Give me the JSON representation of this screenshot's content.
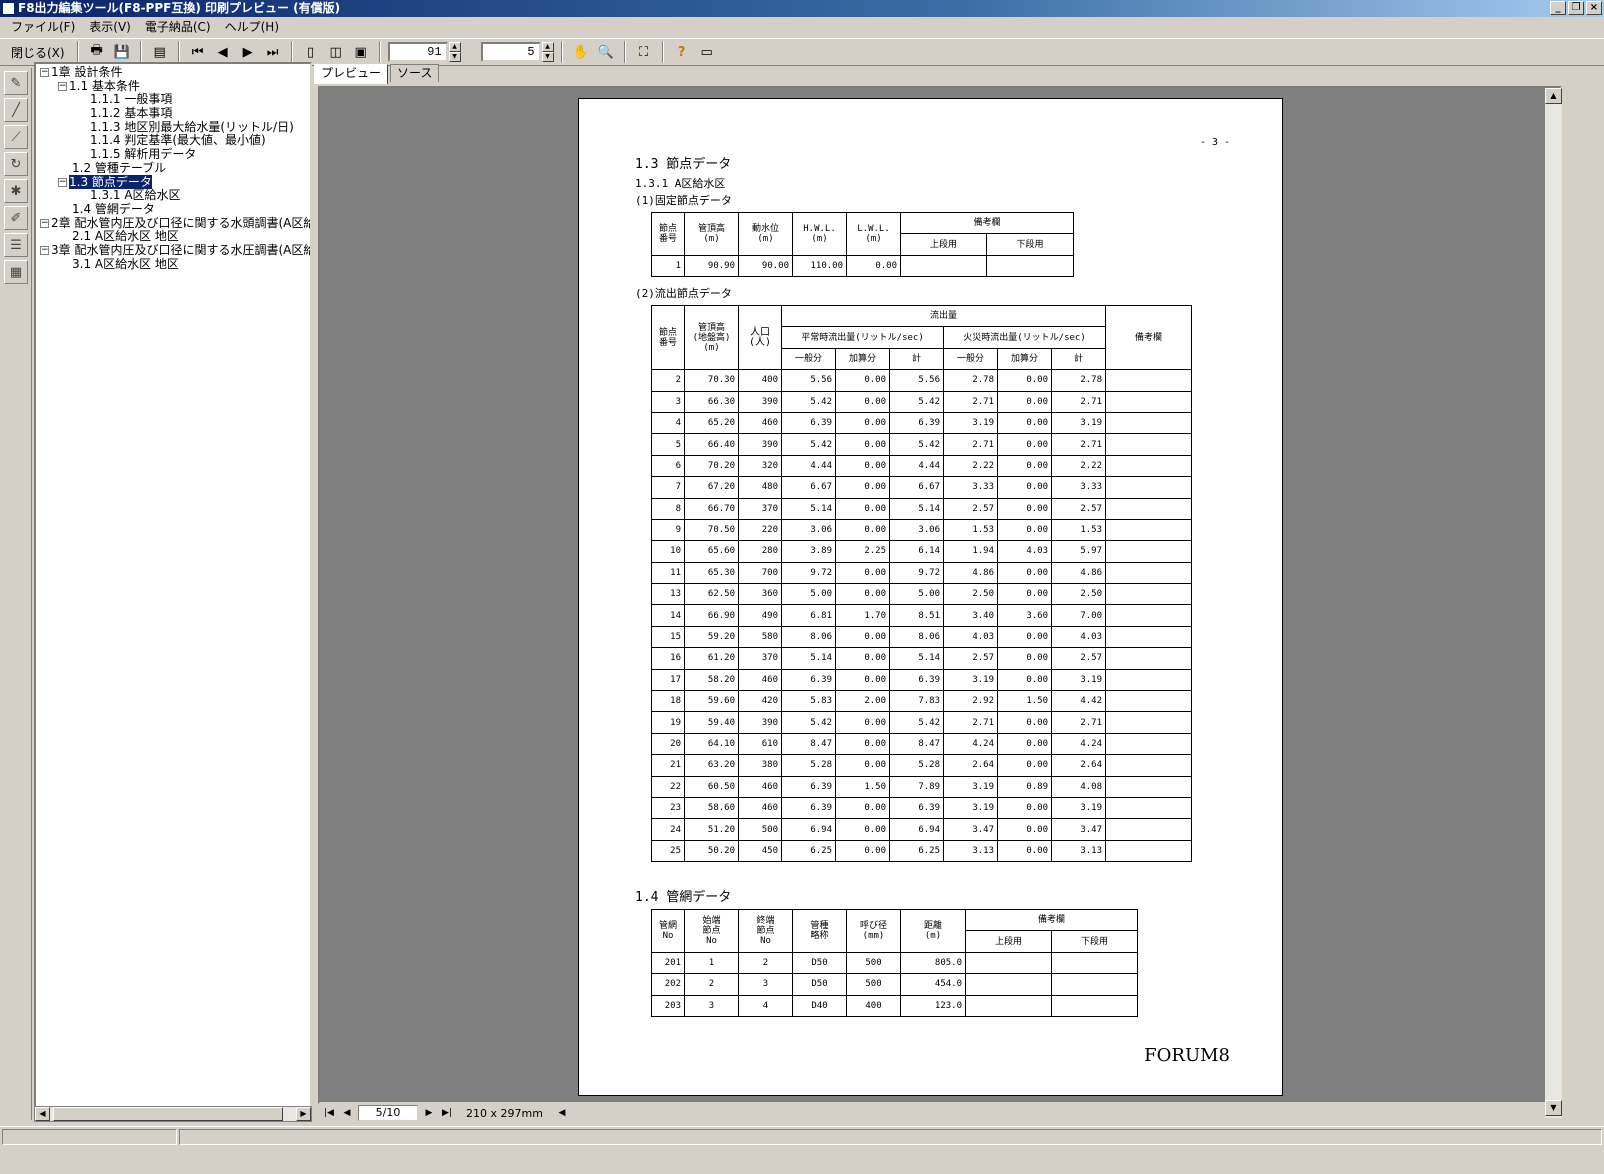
{
  "window": {
    "title": "F8出力編集ツール(F8-PPF互換) 印刷プレビュー (有償版)",
    "minimize": "_",
    "restore": "❐",
    "close": "×"
  },
  "menu": [
    "ファイル(F)",
    "表示(V)",
    "電子納品(C)",
    "ヘルプ(H)"
  ],
  "toolbar": {
    "close_label": "閉じる(X)",
    "zoom_value": "91",
    "page_value": "5"
  },
  "tree": [
    {
      "label": "1章 設計条件",
      "exp": "−"
    },
    {
      "label": "1.1 基本条件",
      "exp": "−"
    },
    {
      "label": "1.1.1 一般事項",
      "exp": ""
    },
    {
      "label": "1.1.2 基本事項",
      "exp": ""
    },
    {
      "label": "1.1.3 地区別最大給水量(リットル/日)",
      "exp": ""
    },
    {
      "label": "1.1.4 判定基準(最大値、最小値)",
      "exp": ""
    },
    {
      "label": "1.1.5 解析用データ",
      "exp": ""
    },
    {
      "label": "1.2 管種テーブル",
      "exp": ""
    },
    {
      "label": "1.3 節点データ",
      "exp": "−"
    },
    {
      "label": "1.3.1 A区給水区",
      "exp": ""
    },
    {
      "label": "1.4 管網データ",
      "exp": ""
    },
    {
      "label": "2章 配水管内圧及び口径に関する水頭調書(A区給",
      "exp": "−"
    },
    {
      "label": "2.1 A区給水区 地区",
      "exp": ""
    },
    {
      "label": "3章 配水管内圧及び口径に関する水圧調書(A区給",
      "exp": "−"
    },
    {
      "label": "3.1 A区給水区 地区",
      "exp": ""
    }
  ],
  "tabs": [
    "プレビュー",
    "ソース"
  ],
  "bottom": {
    "page_indicator": "5/10",
    "paper_size": "210 x 297mm"
  },
  "page": {
    "page_number": "- 3 -",
    "section_13": "1.3 節点データ",
    "section_131": "1.3.1 A区給水区",
    "fixed_title": "(1)固定節点データ",
    "fixed_headers": {
      "node": "節点\n番号",
      "pipe_top": "管頂高\n(m)",
      "water_level": "動水位\n(m)",
      "hwl": "H.W.L.\n(m)",
      "lwl": "L.W.L.\n(m)",
      "remarks": "備考欄",
      "upper": "上段用",
      "lower": "下段用"
    },
    "fixed_rows": [
      [
        "1",
        "90.90",
        "90.00",
        "110.00",
        "0.00",
        "",
        ""
      ]
    ],
    "outflow_title": "(2)流出節点データ",
    "outflow_headers": {
      "node": "節点\n番号",
      "pipe_top": "管頂高\n(地盤高)\n(m)",
      "population": "人口\n(人)",
      "outflow": "流出量",
      "normal": "平常時流出量(リットル/sec)",
      "fire": "火災時流出量(リットル/sec)",
      "general": "一般分",
      "added": "加算分",
      "total": "計",
      "remarks": "備考欄"
    },
    "outflow_rows": [
      [
        "2",
        "70.30",
        "400",
        "5.56",
        "0.00",
        "5.56",
        "2.78",
        "0.00",
        "2.78"
      ],
      [
        "3",
        "66.30",
        "390",
        "5.42",
        "0.00",
        "5.42",
        "2.71",
        "0.00",
        "2.71"
      ],
      [
        "4",
        "65.20",
        "460",
        "6.39",
        "0.00",
        "6.39",
        "3.19",
        "0.00",
        "3.19"
      ],
      [
        "5",
        "66.40",
        "390",
        "5.42",
        "0.00",
        "5.42",
        "2.71",
        "0.00",
        "2.71"
      ],
      [
        "6",
        "70.20",
        "320",
        "4.44",
        "0.00",
        "4.44",
        "2.22",
        "0.00",
        "2.22"
      ],
      [
        "7",
        "67.20",
        "480",
        "6.67",
        "0.00",
        "6.67",
        "3.33",
        "0.00",
        "3.33"
      ],
      [
        "8",
        "66.70",
        "370",
        "5.14",
        "0.00",
        "5.14",
        "2.57",
        "0.00",
        "2.57"
      ],
      [
        "9",
        "70.50",
        "220",
        "3.06",
        "0.00",
        "3.06",
        "1.53",
        "0.00",
        "1.53"
      ],
      [
        "10",
        "65.60",
        "280",
        "3.89",
        "2.25",
        "6.14",
        "1.94",
        "4.03",
        "5.97"
      ],
      [
        "11",
        "65.30",
        "700",
        "9.72",
        "0.00",
        "9.72",
        "4.86",
        "0.00",
        "4.86"
      ],
      [
        "13",
        "62.50",
        "360",
        "5.00",
        "0.00",
        "5.00",
        "2.50",
        "0.00",
        "2.50"
      ],
      [
        "14",
        "66.90",
        "490",
        "6.81",
        "1.70",
        "8.51",
        "3.40",
        "3.60",
        "7.00"
      ],
      [
        "15",
        "59.20",
        "580",
        "8.06",
        "0.00",
        "8.06",
        "4.03",
        "0.00",
        "4.03"
      ],
      [
        "16",
        "61.20",
        "370",
        "5.14",
        "0.00",
        "5.14",
        "2.57",
        "0.00",
        "2.57"
      ],
      [
        "17",
        "58.20",
        "460",
        "6.39",
        "0.00",
        "6.39",
        "3.19",
        "0.00",
        "3.19"
      ],
      [
        "18",
        "59.60",
        "420",
        "5.83",
        "2.00",
        "7.83",
        "2.92",
        "1.50",
        "4.42"
      ],
      [
        "19",
        "59.40",
        "390",
        "5.42",
        "0.00",
        "5.42",
        "2.71",
        "0.00",
        "2.71"
      ],
      [
        "20",
        "64.10",
        "610",
        "8.47",
        "0.00",
        "8.47",
        "4.24",
        "0.00",
        "4.24"
      ],
      [
        "21",
        "63.20",
        "380",
        "5.28",
        "0.00",
        "5.28",
        "2.64",
        "0.00",
        "2.64"
      ],
      [
        "22",
        "60.50",
        "460",
        "6.39",
        "1.50",
        "7.89",
        "3.19",
        "0.89",
        "4.08"
      ],
      [
        "23",
        "58.60",
        "460",
        "6.39",
        "0.00",
        "6.39",
        "3.19",
        "0.00",
        "3.19"
      ],
      [
        "24",
        "51.20",
        "500",
        "6.94",
        "0.00",
        "6.94",
        "3.47",
        "0.00",
        "3.47"
      ],
      [
        "25",
        "50.20",
        "450",
        "6.25",
        "0.00",
        "6.25",
        "3.13",
        "0.00",
        "3.13"
      ]
    ],
    "section_14": "1.4 管網データ",
    "network_headers": {
      "pipe_no": "管網\nNo",
      "start": "始端\n節点\nNo",
      "end": "終端\n節点\nNo",
      "pipe_type": "管種\n略称",
      "diameter": "呼び径\n(mm)",
      "distance": "距離\n(m)",
      "remarks": "備考欄",
      "upper": "上段用",
      "lower": "下段用"
    },
    "network_rows": [
      [
        "201",
        "1",
        "2",
        "D50",
        "500",
        "805.0",
        "",
        ""
      ],
      [
        "202",
        "2",
        "3",
        "D50",
        "500",
        "454.0",
        "",
        ""
      ],
      [
        "203",
        "3",
        "4",
        "D40",
        "400",
        "123.0",
        "",
        ""
      ]
    ],
    "footer_logo": "FORUM8"
  }
}
